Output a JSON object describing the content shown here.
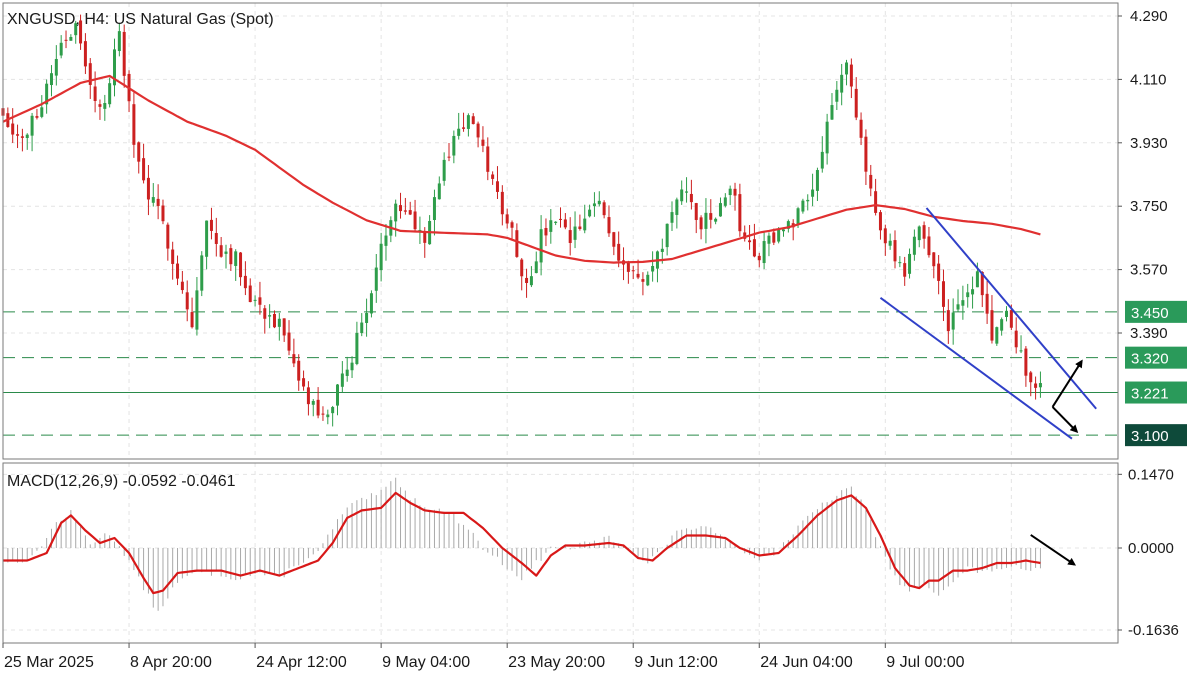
{
  "chart_data": [
    {
      "type": "candlestick",
      "title": "XNGUSD, H4:  US Natural Gas (Spot)",
      "y_ticks": [
        "4.290",
        "4.110",
        "3.930",
        "3.750",
        "3.570",
        "3.390"
      ],
      "ylim": [
        3.085,
        4.305
      ],
      "x_ticks": [
        "25 Mar 2025",
        "8 Apr 20:00",
        "24 Apr 12:00",
        "9 May 04:00",
        "23 May 20:00",
        "9 Jun 12:00",
        "24 Jun 04:00",
        "9 Jul 00:00"
      ],
      "grid": true,
      "colors": {
        "up": "#2e9d4a",
        "down": "#cc2020",
        "ma": "#e03030",
        "trendline": "#3040c8",
        "level": "#2a8a4a",
        "arrow": "#000000"
      },
      "price_series": {
        "name": "XNGUSD",
        "points": [
          [
            0,
            4.02
          ],
          [
            4,
            3.93
          ],
          [
            8,
            4.05
          ],
          [
            12,
            4.22
          ],
          [
            15,
            4.26
          ],
          [
            18,
            4.08
          ],
          [
            21,
            4.03
          ],
          [
            24,
            4.25
          ],
          [
            27,
            3.92
          ],
          [
            30,
            3.78
          ],
          [
            33,
            3.7
          ],
          [
            36,
            3.56
          ],
          [
            39,
            3.41
          ],
          [
            42,
            3.7
          ],
          [
            45,
            3.63
          ],
          [
            48,
            3.6
          ],
          [
            51,
            3.5
          ],
          [
            54,
            3.45
          ],
          [
            57,
            3.41
          ],
          [
            60,
            3.28
          ],
          [
            63,
            3.2
          ],
          [
            66,
            3.14
          ],
          [
            69,
            3.22
          ],
          [
            72,
            3.33
          ],
          [
            75,
            3.46
          ],
          [
            78,
            3.62
          ],
          [
            81,
            3.78
          ],
          [
            84,
            3.72
          ],
          [
            87,
            3.67
          ],
          [
            90,
            3.82
          ],
          [
            93,
            3.95
          ],
          [
            96,
            4.0
          ],
          [
            99,
            3.9
          ],
          [
            102,
            3.78
          ],
          [
            105,
            3.68
          ],
          [
            108,
            3.52
          ],
          [
            111,
            3.66
          ],
          [
            114,
            3.71
          ],
          [
            117,
            3.65
          ],
          [
            120,
            3.71
          ],
          [
            123,
            3.77
          ],
          [
            126,
            3.64
          ],
          [
            129,
            3.57
          ],
          [
            132,
            3.53
          ],
          [
            135,
            3.6
          ],
          [
            138,
            3.74
          ],
          [
            141,
            3.79
          ],
          [
            144,
            3.7
          ],
          [
            147,
            3.72
          ],
          [
            150,
            3.81
          ],
          [
            153,
            3.65
          ],
          [
            156,
            3.61
          ],
          [
            159,
            3.67
          ],
          [
            162,
            3.69
          ],
          [
            165,
            3.76
          ],
          [
            168,
            3.85
          ],
          [
            171,
            4.06
          ],
          [
            174,
            4.14
          ],
          [
            177,
            3.92
          ],
          [
            180,
            3.74
          ],
          [
            183,
            3.63
          ],
          [
            186,
            3.54
          ],
          [
            189,
            3.7
          ],
          [
            192,
            3.58
          ],
          [
            195,
            3.42
          ],
          [
            198,
            3.47
          ],
          [
            201,
            3.55
          ],
          [
            204,
            3.38
          ],
          [
            207,
            3.44
          ],
          [
            210,
            3.32
          ],
          [
            213,
            3.24
          ],
          [
            214,
            3.23
          ]
        ]
      },
      "ma_series": {
        "name": "MA",
        "points": [
          [
            0,
            3.99
          ],
          [
            8,
            4.04
          ],
          [
            16,
            4.1
          ],
          [
            22,
            4.12
          ],
          [
            30,
            4.05
          ],
          [
            38,
            3.99
          ],
          [
            46,
            3.95
          ],
          [
            52,
            3.91
          ],
          [
            56,
            3.87
          ],
          [
            62,
            3.81
          ],
          [
            68,
            3.76
          ],
          [
            75,
            3.71
          ],
          [
            82,
            3.68
          ],
          [
            90,
            3.675
          ],
          [
            100,
            3.67
          ],
          [
            104,
            3.66
          ],
          [
            108,
            3.64
          ],
          [
            114,
            3.61
          ],
          [
            120,
            3.595
          ],
          [
            126,
            3.59
          ],
          [
            132,
            3.592
          ],
          [
            138,
            3.6
          ],
          [
            144,
            3.625
          ],
          [
            150,
            3.65
          ],
          [
            156,
            3.675
          ],
          [
            162,
            3.69
          ],
          [
            168,
            3.715
          ],
          [
            174,
            3.74
          ],
          [
            180,
            3.753
          ],
          [
            186,
            3.742
          ],
          [
            192,
            3.72
          ],
          [
            198,
            3.708
          ],
          [
            204,
            3.7
          ],
          [
            210,
            3.685
          ],
          [
            214,
            3.67
          ]
        ]
      },
      "levels": [
        {
          "value": 3.45,
          "label": "3.450",
          "style": "dashed"
        },
        {
          "value": 3.32,
          "label": "3.320",
          "style": "dashed"
        },
        {
          "value": 3.221,
          "label": "3.221",
          "style": "solid",
          "current": true
        },
        {
          "value": 3.1,
          "label": "3.100",
          "style": "dashed"
        }
      ],
      "channel_lines": [
        [
          [
            190.5,
            3.745
          ],
          [
            225.5,
            3.175
          ]
        ],
        [
          [
            181,
            3.49
          ],
          [
            220.5,
            3.09
          ]
        ]
      ],
      "arrows": [
        [
          [
            216.5,
            3.18
          ],
          [
            222.5,
            3.31
          ]
        ],
        [
          [
            216.5,
            3.18
          ],
          [
            221.5,
            3.11
          ]
        ]
      ]
    },
    {
      "type": "macd",
      "title": "MACD(12,26,9) -0.0592 -0.0461",
      "y_ticks": [
        "0.1470",
        "0.0000",
        "-0.1636"
      ],
      "ylim": [
        -0.1636,
        0.147
      ],
      "grid": true,
      "colors": {
        "histogram": "#a8a8a8",
        "signal": "#d81818",
        "arrow": "#000000"
      },
      "histogram": [
        [
          0,
          -0.03
        ],
        [
          6,
          -0.02
        ],
        [
          11,
          0.05
        ],
        [
          14,
          0.07
        ],
        [
          18,
          0.01
        ],
        [
          22,
          0.03
        ],
        [
          25,
          -0.01
        ],
        [
          29,
          -0.08
        ],
        [
          32,
          -0.13
        ],
        [
          35,
          -0.08
        ],
        [
          39,
          -0.05
        ],
        [
          44,
          -0.05
        ],
        [
          48,
          -0.06
        ],
        [
          53,
          -0.05
        ],
        [
          57,
          -0.06
        ],
        [
          61,
          -0.03
        ],
        [
          65,
          -0.01
        ],
        [
          68,
          0.04
        ],
        [
          71,
          0.08
        ],
        [
          75,
          0.1
        ],
        [
          78,
          0.11
        ],
        [
          81,
          0.14
        ],
        [
          84,
          0.1
        ],
        [
          88,
          0.08
        ],
        [
          92,
          0.07
        ],
        [
          96,
          0.04
        ],
        [
          99,
          0.0
        ],
        [
          103,
          -0.03
        ],
        [
          107,
          -0.06
        ],
        [
          110,
          -0.03
        ],
        [
          113,
          0.0
        ],
        [
          117,
          0.0
        ],
        [
          121,
          0.01
        ],
        [
          125,
          0.02
        ],
        [
          129,
          0.0
        ],
        [
          133,
          -0.03
        ],
        [
          137,
          0.01
        ],
        [
          140,
          0.04
        ],
        [
          144,
          0.04
        ],
        [
          148,
          0.03
        ],
        [
          152,
          0.0
        ],
        [
          156,
          -0.02
        ],
        [
          159,
          -0.01
        ],
        [
          163,
          0.03
        ],
        [
          167,
          0.07
        ],
        [
          171,
          0.1
        ],
        [
          175,
          0.12
        ],
        [
          178,
          0.08
        ],
        [
          181,
          0.0
        ],
        [
          184,
          -0.06
        ],
        [
          187,
          -0.09
        ],
        [
          190,
          -0.07
        ],
        [
          193,
          -0.09
        ],
        [
          196,
          -0.07
        ],
        [
          199,
          -0.04
        ],
        [
          202,
          -0.05
        ],
        [
          205,
          -0.04
        ],
        [
          209,
          -0.04
        ],
        [
          212,
          -0.05
        ],
        [
          214,
          -0.04
        ]
      ],
      "signal": [
        [
          0,
          -0.025
        ],
        [
          5,
          -0.025
        ],
        [
          9,
          -0.01
        ],
        [
          12,
          0.05
        ],
        [
          14,
          0.065
        ],
        [
          17,
          0.035
        ],
        [
          20,
          0.01
        ],
        [
          23,
          0.02
        ],
        [
          26,
          -0.01
        ],
        [
          29,
          -0.06
        ],
        [
          31,
          -0.09
        ],
        [
          33,
          -0.085
        ],
        [
          36,
          -0.05
        ],
        [
          40,
          -0.045
        ],
        [
          45,
          -0.045
        ],
        [
          49,
          -0.055
        ],
        [
          53,
          -0.045
        ],
        [
          57,
          -0.055
        ],
        [
          61,
          -0.04
        ],
        [
          65,
          -0.025
        ],
        [
          68,
          0.01
        ],
        [
          71,
          0.06
        ],
        [
          74,
          0.075
        ],
        [
          78,
          0.08
        ],
        [
          81,
          0.11
        ],
        [
          84,
          0.09
        ],
        [
          87,
          0.075
        ],
        [
          91,
          0.07
        ],
        [
          95,
          0.07
        ],
        [
          99,
          0.04
        ],
        [
          103,
          0.0
        ],
        [
          107,
          -0.03
        ],
        [
          110,
          -0.055
        ],
        [
          113,
          -0.015
        ],
        [
          116,
          0.005
        ],
        [
          120,
          0.005
        ],
        [
          125,
          0.01
        ],
        [
          128,
          0.005
        ],
        [
          131,
          -0.02
        ],
        [
          134,
          -0.025
        ],
        [
          137,
          0.0
        ],
        [
          141,
          0.025
        ],
        [
          145,
          0.025
        ],
        [
          149,
          0.02
        ],
        [
          152,
          0.0
        ],
        [
          156,
          -0.015
        ],
        [
          160,
          -0.01
        ],
        [
          164,
          0.025
        ],
        [
          168,
          0.065
        ],
        [
          172,
          0.095
        ],
        [
          175,
          0.105
        ],
        [
          178,
          0.08
        ],
        [
          181,
          0.025
        ],
        [
          184,
          -0.04
        ],
        [
          187,
          -0.075
        ],
        [
          189,
          -0.08
        ],
        [
          191,
          -0.065
        ],
        [
          193,
          -0.065
        ],
        [
          196,
          -0.045
        ],
        [
          199,
          -0.045
        ],
        [
          202,
          -0.04
        ],
        [
          205,
          -0.03
        ],
        [
          208,
          -0.03
        ],
        [
          211,
          -0.025
        ],
        [
          214,
          -0.03
        ]
      ],
      "arrows": [
        [
          [
            212,
            0.026
          ],
          [
            221,
            -0.033
          ]
        ]
      ]
    }
  ]
}
